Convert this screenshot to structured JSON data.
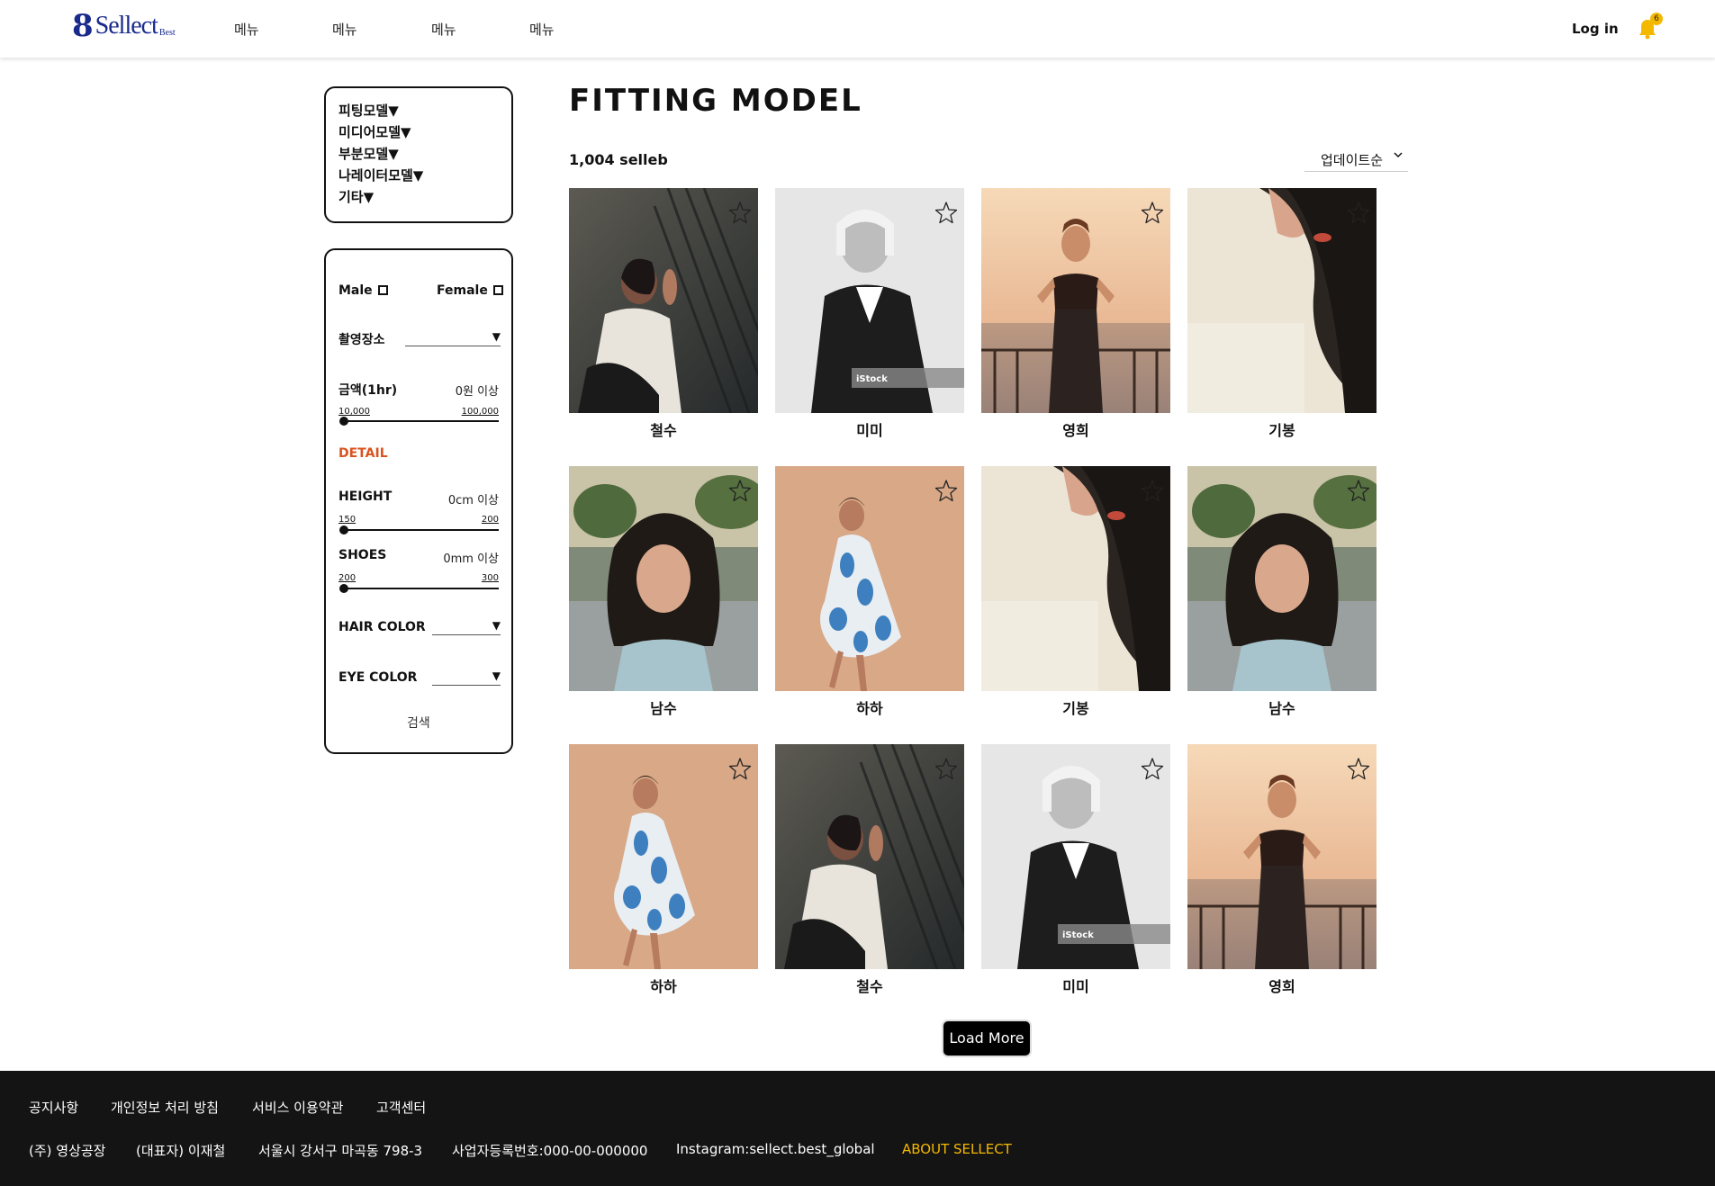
{
  "header": {
    "logo_mark": "8",
    "logo_text": "Sellect",
    "logo_sub": "Best",
    "nav": [
      "메뉴",
      "메뉴",
      "메뉴",
      "메뉴"
    ],
    "login_label": "Log in",
    "notification_count": "6",
    "bell_color": "#f5b800"
  },
  "sidebar": {
    "categories": [
      "피팅모델▼",
      "미디어모델▼",
      "부분모델▼",
      "나레이터모델▼",
      "기타▼"
    ],
    "filters": {
      "male_label": "Male",
      "female_label": "Female",
      "location_label": "촬영장소",
      "price_label": "금액(1hr)",
      "price_value": "0원 이상",
      "price_min": "10,000",
      "price_max": "100,000",
      "detail_label": "DETAIL",
      "height_label": "HEIGHT",
      "height_value": "0cm 이상",
      "height_min": "150",
      "height_max": "200",
      "shoes_label": "SHOES",
      "shoes_value": "0mm 이상",
      "shoes_min": "200",
      "shoes_max": "300",
      "hair_color_label": "HAIR COLOR",
      "eye_color_label": "EYE COLOR",
      "search_label": "검색",
      "detail_color": "#d9531e"
    }
  },
  "main": {
    "title": "FITTING MODEL",
    "count": "1,004 selleb",
    "sort_label": "업데이트순",
    "models": [
      {
        "name": "철수",
        "photo": "bw-fence"
      },
      {
        "name": "미미",
        "photo": "bw-blazer"
      },
      {
        "name": "영희",
        "photo": "sunset-railing"
      },
      {
        "name": "기봉",
        "photo": "hair-closeup"
      },
      {
        "name": "남수",
        "photo": "street-portrait"
      },
      {
        "name": "하하",
        "photo": "blue-dress"
      },
      {
        "name": "기봉",
        "photo": "hair-closeup"
      },
      {
        "name": "남수",
        "photo": "street-portrait"
      },
      {
        "name": "하하",
        "photo": "blue-dress"
      },
      {
        "name": "철수",
        "photo": "bw-fence"
      },
      {
        "name": "미미",
        "photo": "bw-blazer"
      },
      {
        "name": "영희",
        "photo": "sunset-railing"
      }
    ],
    "istock_label": "iStock",
    "load_more_label": "Load More"
  },
  "footer": {
    "links": [
      "공지사항",
      "개인정보 처리 방침",
      "서비스 이용약관",
      "고객센터"
    ],
    "company": "(주) 영상공장",
    "ceo": "(대표자) 이재철",
    "address": "서울시 강서구 마곡동 798-3",
    "business_no": "사업자등록번호:000-00-000000",
    "instagram": "Instagram:sellect.best_global",
    "about": "ABOUT SELLECT",
    "about_color": "#f5b800"
  }
}
